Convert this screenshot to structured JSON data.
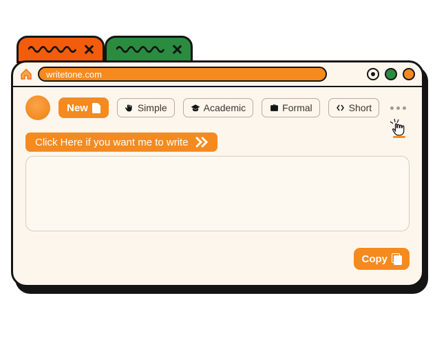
{
  "url": "writetone.com",
  "tabs": {
    "count": 2,
    "colors": [
      "#f25c0c",
      "#2b8b3f"
    ]
  },
  "buttons": {
    "new": "New",
    "copy": "Copy"
  },
  "chips": [
    {
      "label": "Simple",
      "icon": "hand-icon"
    },
    {
      "label": "Academic",
      "icon": "graduation-cap-icon"
    },
    {
      "label": "Formal",
      "icon": "briefcase-icon"
    },
    {
      "label": "Short",
      "icon": "collapse-icon"
    }
  ],
  "prompt_label": "Click Here if you want me to write",
  "output_text": "",
  "colors": {
    "accent": "#f58a1f",
    "ink": "#141414",
    "panel": "#fcf6ed"
  }
}
